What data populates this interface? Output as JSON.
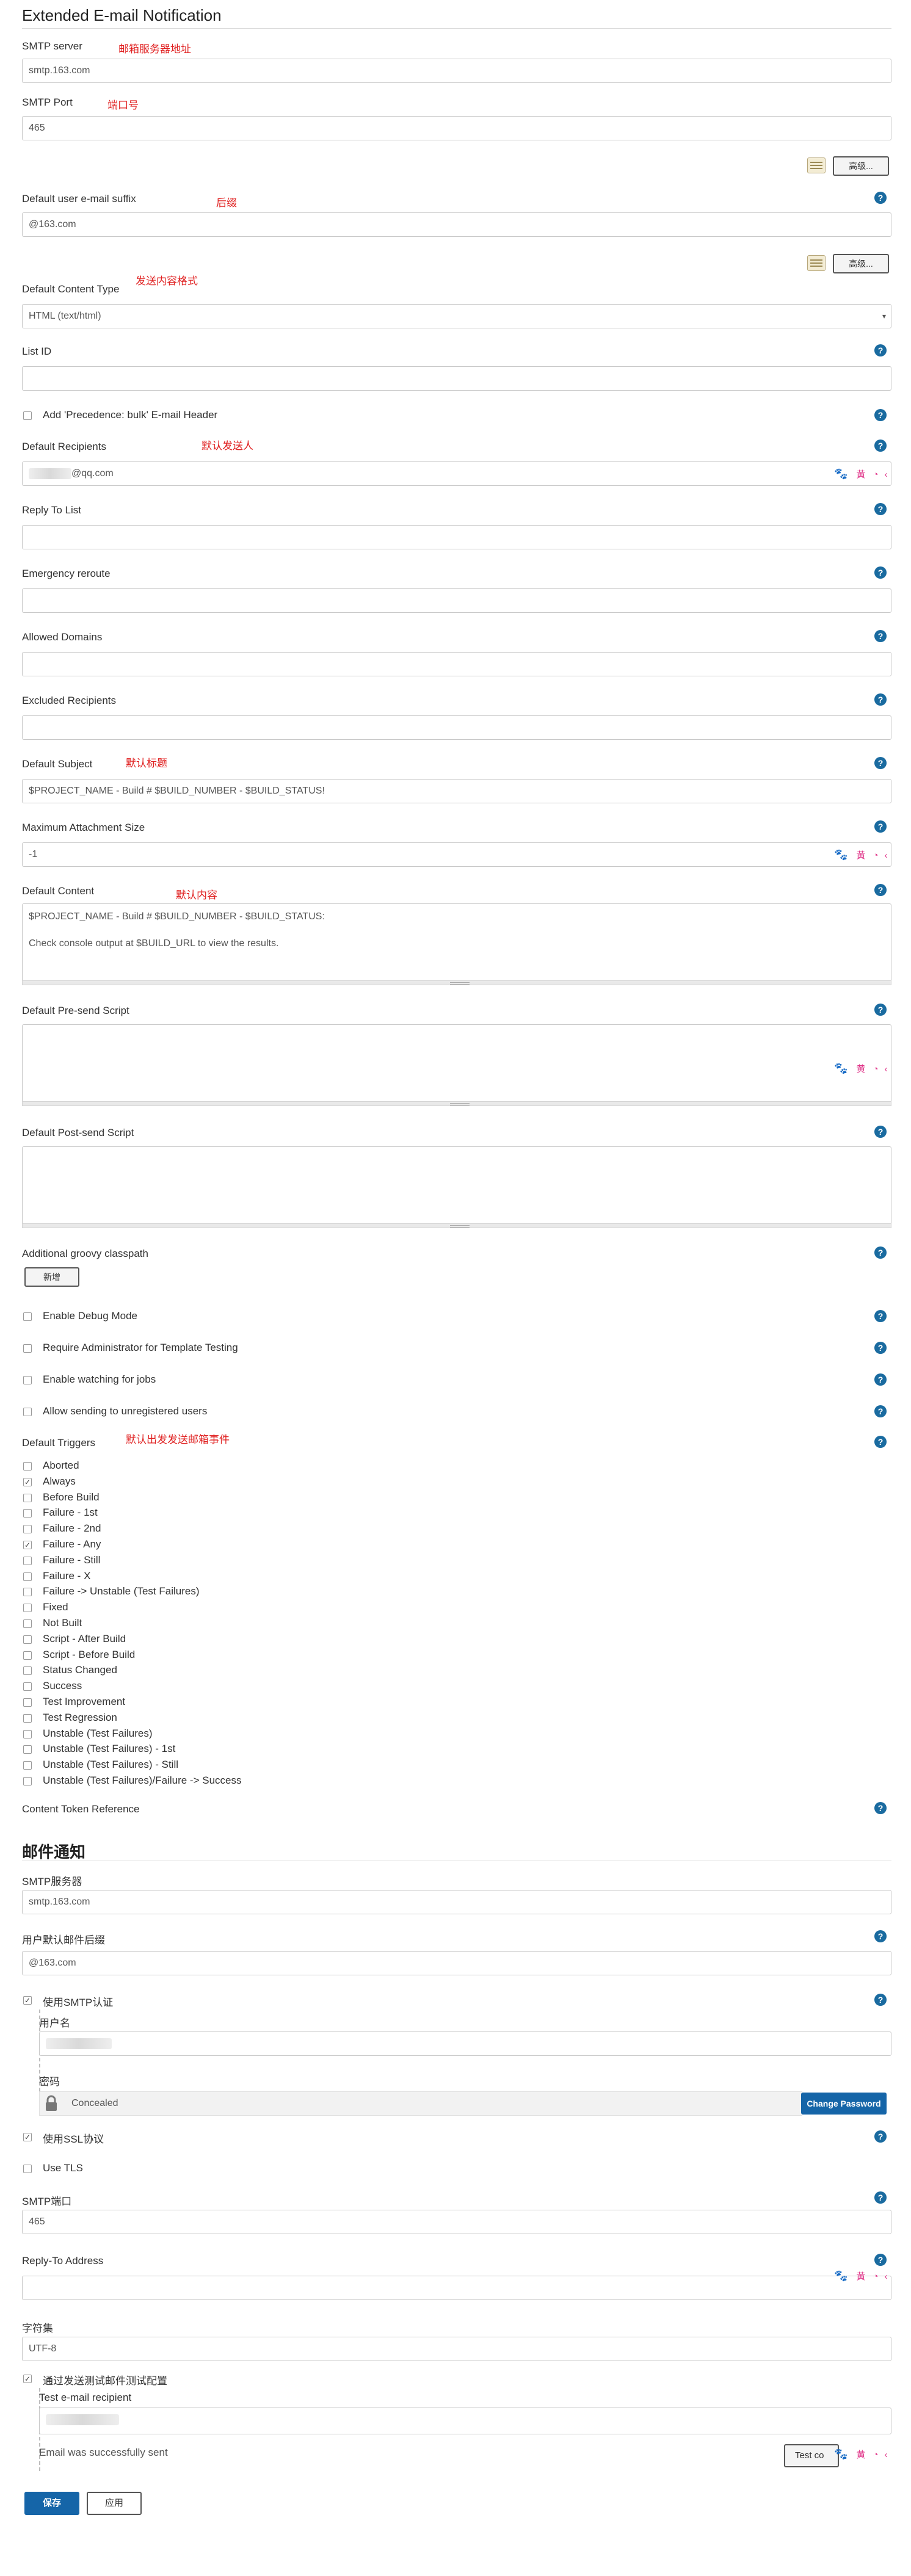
{
  "ext": {
    "title": "Extended E-mail Notification",
    "smtp_server_label": "SMTP server",
    "smtp_server_note": "邮箱服务器地址",
    "smtp_server_value": "smtp.163.com",
    "smtp_port_label": "SMTP Port",
    "smtp_port_note": "端口号",
    "smtp_port_value": "465",
    "advanced_label": "高级...",
    "suffix_label": "Default user e-mail suffix",
    "suffix_note": "后缀",
    "suffix_value": "@163.com",
    "content_type_label": "Default Content Type",
    "content_type_note": "发送内容格式",
    "content_type_value": "HTML (text/html)",
    "list_id_label": "List ID",
    "precedence_label": "Add 'Precedence: bulk' E-mail Header",
    "recipients_label": "Default Recipients",
    "recipients_note": "默认发送人",
    "recipients_value": "@qq.com",
    "reply_to_label": "Reply To List",
    "emergency_label": "Emergency reroute",
    "allowed_domains_label": "Allowed Domains",
    "excluded_label": "Excluded Recipients",
    "subject_label": "Default Subject",
    "subject_note": "默认标题",
    "subject_value": "$PROJECT_NAME - Build # $BUILD_NUMBER - $BUILD_STATUS!",
    "max_attach_label": "Maximum Attachment Size",
    "max_attach_value": "-1",
    "content_label": "Default Content",
    "content_note": "默认内容",
    "content_value": "$PROJECT_NAME - Build # $BUILD_NUMBER - $BUILD_STATUS:\n\nCheck console output at $BUILD_URL to view the results.",
    "presend_label": "Default Pre-send Script",
    "postsend_label": "Default Post-send Script",
    "groovy_label": "Additional groovy classpath",
    "add_label": "新增",
    "debug_label": "Enable Debug Mode",
    "admin_label": "Require Administrator for Template Testing",
    "watching_label": "Enable watching for jobs",
    "unregistered_label": "Allow sending to unregistered users",
    "triggers_label": "Default Triggers",
    "triggers_note": "默认出发发送邮箱事件",
    "triggers": [
      {
        "label": "Aborted",
        "checked": false
      },
      {
        "label": "Always",
        "checked": true
      },
      {
        "label": "Before Build",
        "checked": false
      },
      {
        "label": "Failure - 1st",
        "checked": false
      },
      {
        "label": "Failure - 2nd",
        "checked": false
      },
      {
        "label": "Failure - Any",
        "checked": true
      },
      {
        "label": "Failure - Still",
        "checked": false
      },
      {
        "label": "Failure - X",
        "checked": false
      },
      {
        "label": "Failure -> Unstable (Test Failures)",
        "checked": false
      },
      {
        "label": "Fixed",
        "checked": false
      },
      {
        "label": "Not Built",
        "checked": false
      },
      {
        "label": "Script - After Build",
        "checked": false
      },
      {
        "label": "Script - Before Build",
        "checked": false
      },
      {
        "label": "Status Changed",
        "checked": false
      },
      {
        "label": "Success",
        "checked": false
      },
      {
        "label": "Test Improvement",
        "checked": false
      },
      {
        "label": "Test Regression",
        "checked": false
      },
      {
        "label": "Unstable (Test Failures)",
        "checked": false
      },
      {
        "label": "Unstable (Test Failures) - 1st",
        "checked": false
      },
      {
        "label": "Unstable (Test Failures) - Still",
        "checked": false
      },
      {
        "label": "Unstable (Test Failures)/Failure -> Success",
        "checked": false
      }
    ],
    "token_ref_label": "Content Token Reference"
  },
  "mail": {
    "title": "邮件通知",
    "smtp_server_label": "SMTP服务器",
    "smtp_server_value": "smtp.163.com",
    "suffix_label": "用户默认邮件后缀",
    "suffix_value": "@163.com",
    "use_auth_label": "使用SMTP认证",
    "username_label": "用户名",
    "password_label": "密码",
    "password_value": "Concealed",
    "change_password_label": "Change Password",
    "use_ssl_label": "使用SSL协议",
    "use_tls_label": "Use TLS",
    "port_label": "SMTP端口",
    "port_value": "465",
    "reply_to_label": "Reply-To Address",
    "charset_label": "字符集",
    "charset_value": "UTF-8",
    "test_config_label": "通过发送测试邮件测试配置",
    "test_recipient_label": "Test e-mail recipient",
    "success_text": "Email was successfully sent",
    "test_button_label": "Test co"
  },
  "footer": {
    "save_label": "保存",
    "apply_label": "应用"
  },
  "helper_tools": [
    "🐾",
    "黄",
    "◔",
    "‹"
  ]
}
